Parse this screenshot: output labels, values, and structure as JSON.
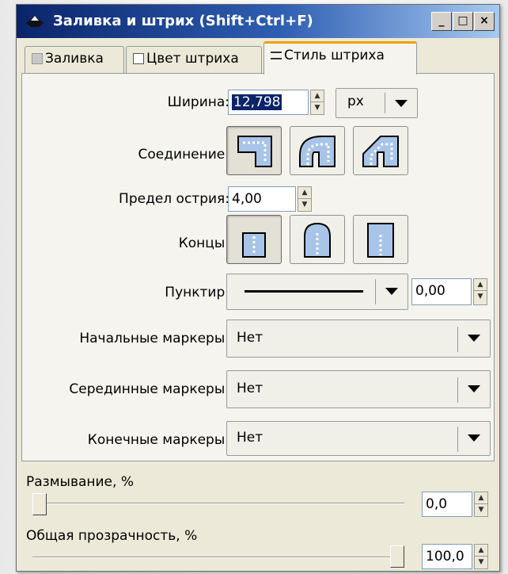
{
  "window": {
    "title": "Заливка и штрих (Shift+Ctrl+F)",
    "minimize": "_",
    "maximize": "□",
    "close": "×"
  },
  "tabs": [
    {
      "label": "Заливка",
      "active": false
    },
    {
      "label": "Цвет штриха",
      "active": false
    },
    {
      "label": "Стиль штриха",
      "active": true
    }
  ],
  "stroke_style": {
    "width_label": "Ширина:",
    "width_value": "12,798",
    "unit": "px",
    "join_label": "Соединение:",
    "join_options": [
      "miter",
      "round",
      "bevel"
    ],
    "join_selected": "miter",
    "miter_label": "Предел острия:",
    "miter_value": "4,00",
    "cap_label": "Концы:",
    "cap_options": [
      "butt",
      "round",
      "square"
    ],
    "cap_selected": "butt",
    "dash_label": "Пунктир:",
    "dash_offset": "0,00",
    "start_markers_label": "Начальные маркеры:",
    "start_markers_value": "Нет",
    "mid_markers_label": "Серединные маркеры:",
    "mid_markers_value": "Нет",
    "end_markers_label": "Конечные маркеры:",
    "end_markers_value": "Нет"
  },
  "blur": {
    "label": "Размывание, %",
    "value": "0,0",
    "level_percent": 0
  },
  "opacity": {
    "label": "Общая прозрачность, %",
    "value": "100,0",
    "level_percent": 100
  },
  "colors": {
    "title_start": "#0a246a",
    "title_end": "#a6caf0",
    "active_tab_accent": "#f0a000",
    "button_fill": "#a8c4e8"
  }
}
